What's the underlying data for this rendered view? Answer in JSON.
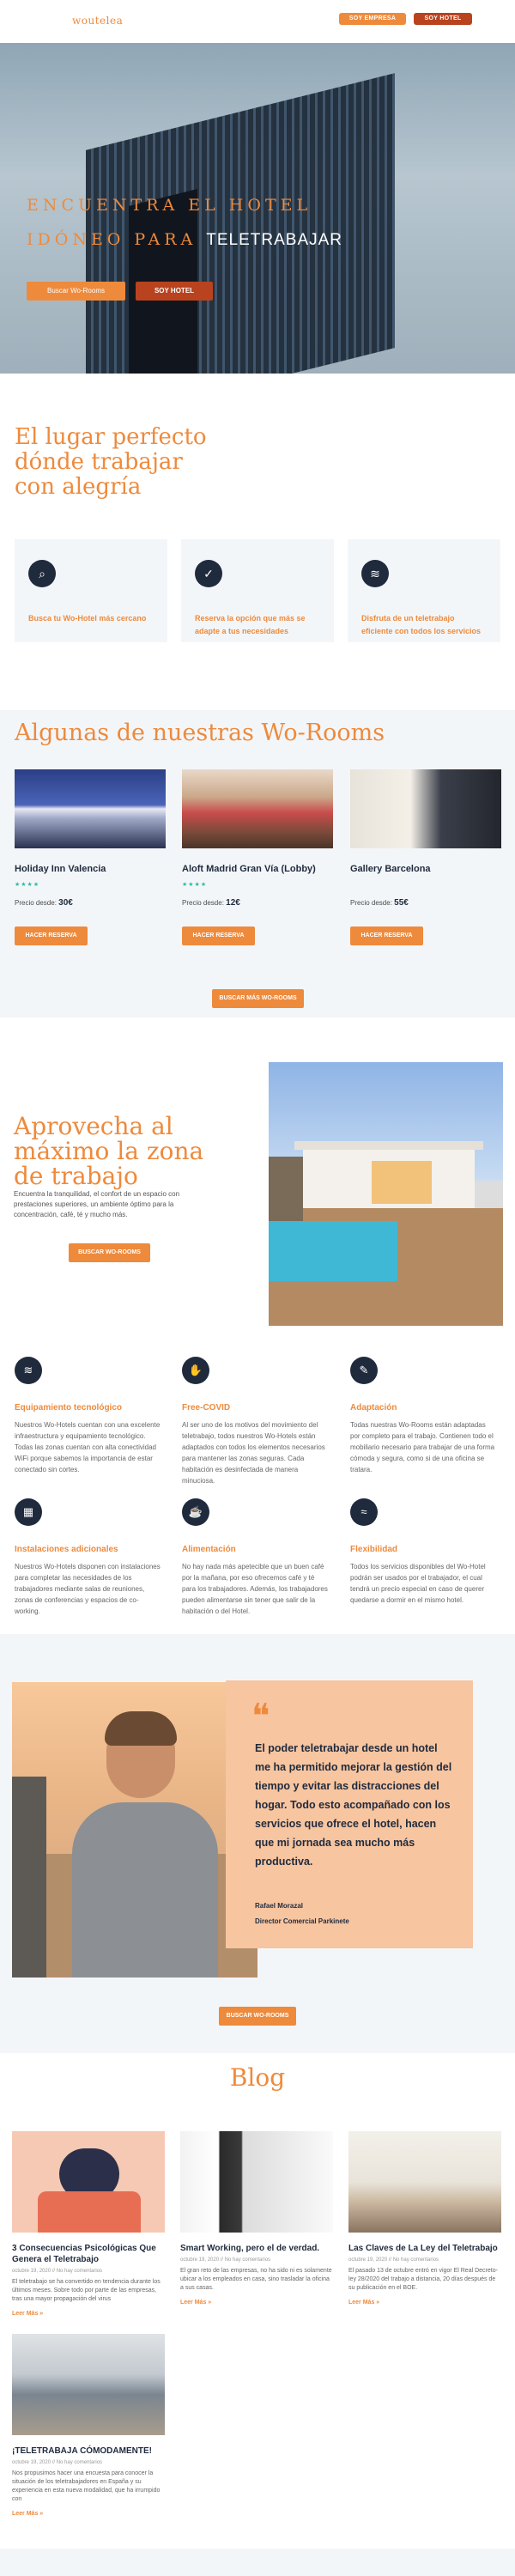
{
  "header": {
    "logo": "woutelea",
    "btn_company": "SOY EMPRESA",
    "btn_hotel": "SOY HOTEL"
  },
  "hero": {
    "title_line1": "ENCUENTRA EL HOTEL",
    "title_line2_a": "IDÓNEO PARA",
    "title_line2_b": "TELETRABAJAR",
    "btn_search": "Buscar Wo-Rooms",
    "btn_hotel": "SOY HOTEL"
  },
  "intro": {
    "title": "El lugar perfecto dónde trabajar con alegría",
    "cards": [
      {
        "icon": "search-icon",
        "glyph": "⌕",
        "text": "Busca tu Wo-Hotel más cercano"
      },
      {
        "icon": "check-icon",
        "glyph": "✓",
        "text": "Reserva la opción que más se adapte a tus necesidades"
      },
      {
        "icon": "wifi-icon",
        "glyph": "≋",
        "text": "Disfruta de un teletrabajo eficiente con todos los servicios"
      }
    ]
  },
  "rooms": {
    "title": "Algunas de nuestras Wo-Rooms",
    "items": [
      {
        "name": "Holiday Inn Valencia",
        "stars": "★★★★",
        "price_label": "Precio desde:",
        "price": "30€",
        "button": "HACER RESERVA"
      },
      {
        "name": "Aloft Madrid Gran Vía (Lobby)",
        "stars": "★★★★",
        "price_label": "Precio desde:",
        "price": "12€",
        "button": "HACER RESERVA"
      },
      {
        "name": "Gallery Barcelona",
        "stars": "",
        "price_label": "Precio desde:",
        "price": "55€",
        "button": "HACER RESERVA"
      }
    ],
    "more_button": "BUSCAR MÁS WO-ROOMS"
  },
  "enjoy": {
    "title": "Aprovecha al máximo la zona de trabajo",
    "description": "Encuentra la tranquilidad, el confort de un espacio con prestaciones superiores, un ambiente óptimo para la concentración, café, té y mucho más.",
    "button": "BUSCAR WO-ROOMS"
  },
  "amenities": [
    {
      "icon": "wifi-icon",
      "glyph": "≋",
      "title": "Equipamiento tecnológico",
      "text": "Nuestros Wo-Hotels cuentan con una excelente infraestructura y equipamiento tecnológico. Todas las zonas cuentan con alta conectividad WiFi porque sabemos la importancia de estar conectado sin cortes."
    },
    {
      "icon": "handshake-icon",
      "glyph": "✋",
      "title": "Free-COVID",
      "text": "Al ser uno de los motivos del movimiento del teletrabajo, todos nuestros Wo-Hotels están adaptados con todos los elementos necesarios para mantener las zonas seguras. Cada habitación es desinfectada de manera minuciosa."
    },
    {
      "icon": "chat-icon",
      "glyph": "✎",
      "title": "Adaptación",
      "text": "Todas nuestras Wo-Rooms están adaptadas por completo para el trabajo. Contienen todo el mobiliario necesario para trabajar de una forma cómoda y segura, como si de una oficina se tratara."
    },
    {
      "icon": "building-icon",
      "glyph": "▦",
      "title": "Instalaciones adicionales",
      "text": "Nuestros Wo-Hotels disponen con instalaciones para completar las necesidades de los trabajadores mediante salas de reuniones, zonas de conferencias y espacios de co-working."
    },
    {
      "icon": "coffee-icon",
      "glyph": "☕",
      "title": "Alimentación",
      "text": "No hay nada más apetecible que un buen café por la mañana, por eso ofrecemos café y té para los trabajadores. Además, los trabajadores pueden alimentarse sin tener que salir de la habitación o del Hotel."
    },
    {
      "icon": "pool-icon",
      "glyph": "≈",
      "title": "Flexibilidad",
      "text": "Todos los servicios disponibles del Wo-Hotel podrán ser usados por el trabajador, el cual tendrá un precio especial en caso de querer quedarse a dormir en el mismo hotel."
    }
  ],
  "testimonial": {
    "quote_mark": "❝",
    "quote": "El poder teletrabajar desde un hotel me ha permitido mejorar la gestión del tiempo y evitar las distracciones del hogar. Todo esto acompañado con los servicios que ofrece el hotel, hacen que mi jornada sea mucho más productiva.",
    "name": "Rafael Morazal",
    "role": "Director Comercial Parkinete",
    "button": "BUSCAR WO-ROOMS"
  },
  "blog": {
    "title": "Blog",
    "posts": [
      {
        "title": "3 Consecuencias Psicológicas Que Genera el Teletrabajo",
        "meta": "octubre 19, 2020 // No hay comentarios",
        "excerpt": "El teletrabajo se ha convertido en tendencia durante los últimos meses. Sobre todo por parte de las empresas, tras una mayor propagación del virus",
        "link": "Leer Más »"
      },
      {
        "title": "Smart Working, pero el de verdad.",
        "meta": "octubre 19, 2020 // No hay comentarios",
        "excerpt": "El gran reto de las empresas, no ha sido ni es solamente ubicar a los empleados en casa, sino trasladar la oficina a sus casas.",
        "link": "Leer Más »"
      },
      {
        "title": "Las Claves de La Ley del Teletrabajo",
        "meta": "octubre 19, 2020 // No hay comentarios",
        "excerpt": "El pasado 13 de octubre entró en vigor El Real Decreto-ley 28/2020 del trabajo a distancia, 20 días después de su publicación en el BOE.",
        "link": "Leer Más »"
      },
      {
        "title": "¡TELETRABAJA CÓMODAMENTE!",
        "meta": "octubre 19, 2020 // No hay comentarios",
        "excerpt": "Nos propusimos hacer una encuesta para conocer la situación de los teletrabajadores en España y su experiencia en esta nueva modalidad, que ha irrumpido con",
        "link": "Leer Más »"
      }
    ]
  }
}
